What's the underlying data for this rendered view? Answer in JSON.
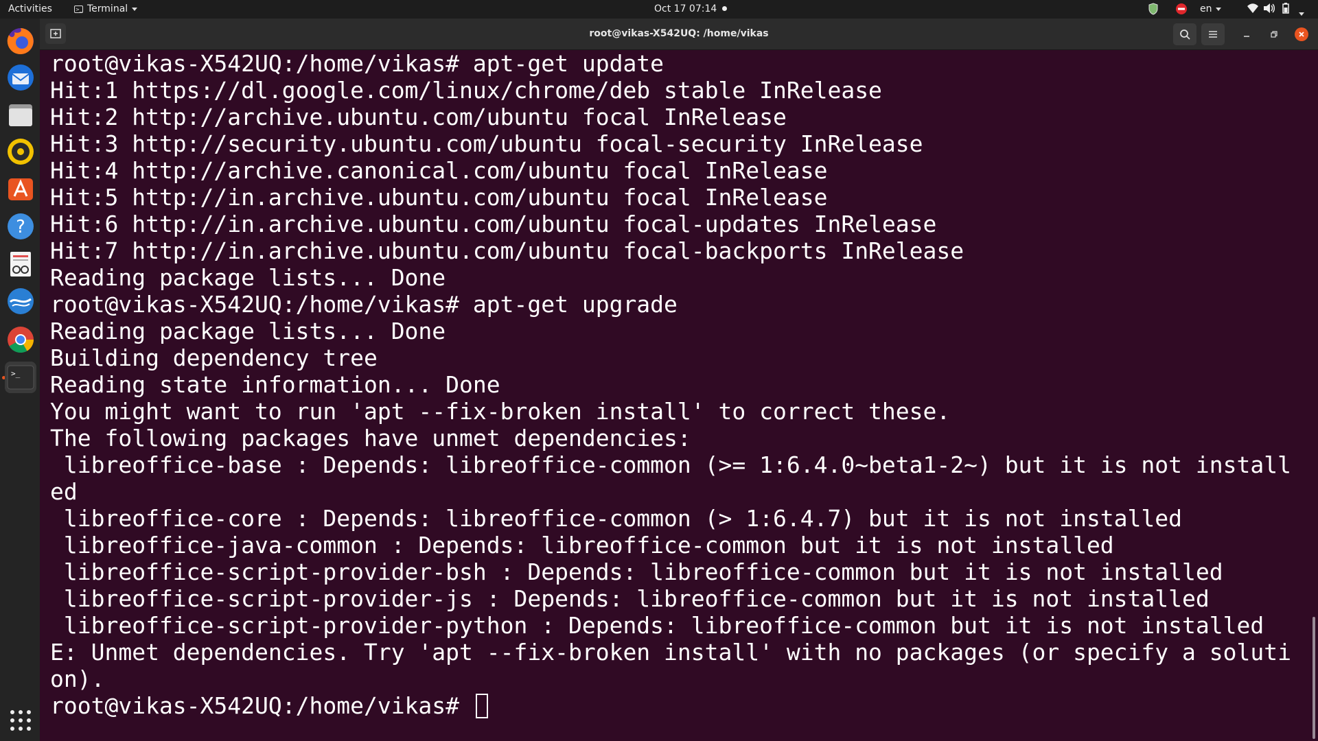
{
  "topbar": {
    "activities": "Activities",
    "app_menu": "Terminal",
    "clock": "Oct 17  07:14",
    "language": "en"
  },
  "dock": {
    "items": [
      {
        "name": "Firefox",
        "icon": "firefox-icon"
      },
      {
        "name": "Thunderbird",
        "icon": "thunderbird-icon"
      },
      {
        "name": "Files",
        "icon": "files-icon"
      },
      {
        "name": "Rhythmbox",
        "icon": "rhythmbox-icon"
      },
      {
        "name": "Ubuntu Software",
        "icon": "software-icon"
      },
      {
        "name": "Help",
        "icon": "help-icon"
      },
      {
        "name": "Document Viewer",
        "icon": "document-viewer-icon"
      },
      {
        "name": "OpenOffice Writer",
        "icon": "openoffice-icon"
      },
      {
        "name": "Google Chrome",
        "icon": "chrome-icon"
      },
      {
        "name": "Terminal",
        "icon": "terminal-icon"
      }
    ]
  },
  "window": {
    "title": "root@vikas-X542UQ: /home/vikas"
  },
  "terminal": {
    "lines": [
      "root@vikas-X542UQ:/home/vikas# apt-get update",
      "Hit:1 https://dl.google.com/linux/chrome/deb stable InRelease",
      "Hit:2 http://archive.ubuntu.com/ubuntu focal InRelease",
      "Hit:3 http://security.ubuntu.com/ubuntu focal-security InRelease",
      "Hit:4 http://archive.canonical.com/ubuntu focal InRelease",
      "Hit:5 http://in.archive.ubuntu.com/ubuntu focal InRelease",
      "Hit:6 http://in.archive.ubuntu.com/ubuntu focal-updates InRelease",
      "Hit:7 http://in.archive.ubuntu.com/ubuntu focal-backports InRelease",
      "Reading package lists... Done",
      "root@vikas-X542UQ:/home/vikas# apt-get upgrade",
      "Reading package lists... Done",
      "Building dependency tree",
      "Reading state information... Done",
      "You might want to run 'apt --fix-broken install' to correct these.",
      "The following packages have unmet dependencies:",
      " libreoffice-base : Depends: libreoffice-common (>= 1:6.4.0~beta1-2~) but it is not install",
      "ed",
      " libreoffice-core : Depends: libreoffice-common (> 1:6.4.7) but it is not installed",
      " libreoffice-java-common : Depends: libreoffice-common but it is not installed",
      " libreoffice-script-provider-bsh : Depends: libreoffice-common but it is not installed",
      " libreoffice-script-provider-js : Depends: libreoffice-common but it is not installed",
      " libreoffice-script-provider-python : Depends: libreoffice-common but it is not installed",
      "E: Unmet dependencies. Try 'apt --fix-broken install' with no packages (or specify a soluti",
      "on)."
    ],
    "prompt": "root@vikas-X542UQ:/home/vikas# "
  },
  "colors": {
    "terminal_bg": "#300a24",
    "accent": "#e95420",
    "panel": "#1d1d1d"
  }
}
